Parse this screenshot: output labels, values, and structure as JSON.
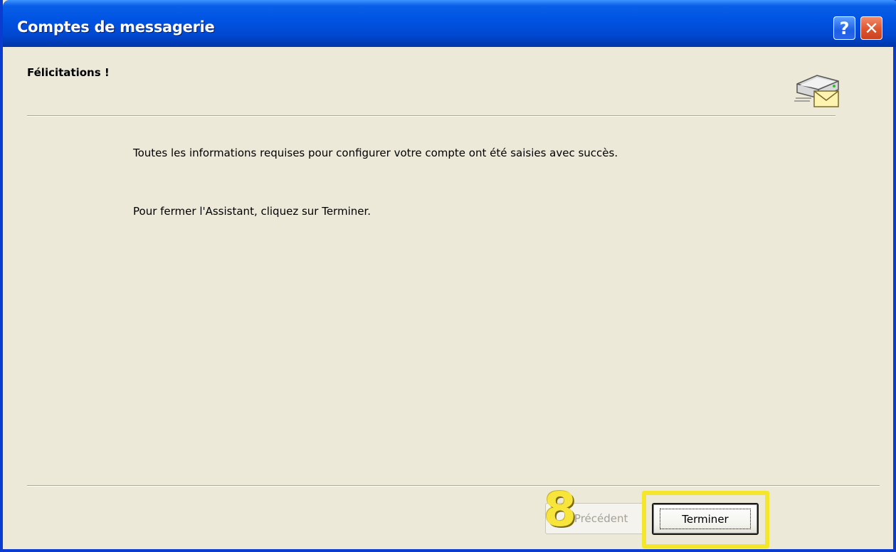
{
  "window": {
    "title": "Comptes de messagerie",
    "help_label": "?",
    "close_label": "✕"
  },
  "page": {
    "heading": "Félicitations !",
    "icon": "mail-server-icon",
    "message_line1": "Toutes les informations requises pour configurer votre compte ont été saisies avec succès.",
    "message_line2": "Pour fermer l'Assistant, cliquez sur Terminer."
  },
  "buttons": {
    "previous_label": "< Précédent",
    "finish_label": "Terminer"
  },
  "annotation": {
    "step_number": "8",
    "color": "#F3E62B"
  },
  "colors": {
    "titlebar": "#0054E3",
    "dialog_bg": "#ECE9D8"
  }
}
